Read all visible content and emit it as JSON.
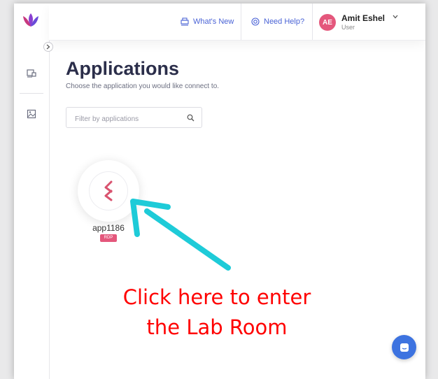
{
  "topbar": {
    "whats_new": "What's New",
    "need_help": "Need Help?",
    "user_initials": "AE",
    "user_name": "Amit Eshel",
    "user_role": "User"
  },
  "page": {
    "title": "Applications",
    "subtitle": "Choose the application you would like connect to."
  },
  "filter": {
    "placeholder": "Filter by applications",
    "value": ""
  },
  "apps": [
    {
      "name": "app1186",
      "badge": "RDP"
    }
  ],
  "annotation": {
    "line1": "Click here to enter",
    "line2": "the Lab Room"
  },
  "colors": {
    "accent_blue": "#4a63d6",
    "brand_pink": "#e4577c",
    "arrow_cyan": "#1ecbd8",
    "annotation_red": "#ff0000",
    "chat_blue": "#3d73e0"
  }
}
